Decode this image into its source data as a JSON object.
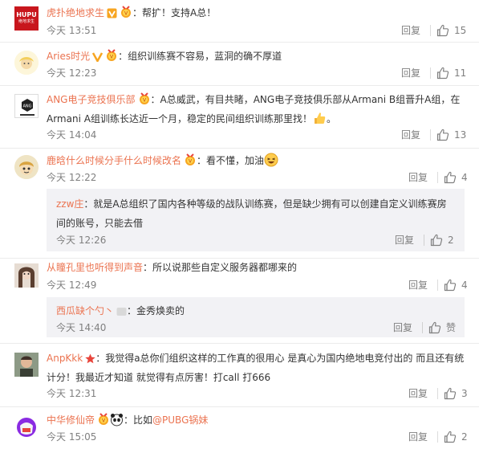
{
  "comments": [
    {
      "username": "虎扑绝地求生",
      "text": "：帮扩！支持A总！",
      "time": "今天 13:51",
      "reply_label": "回复",
      "likes": "15",
      "avatar_text": "HUPU",
      "avatar_subtext": "绝地求生"
    },
    {
      "username": "Aries时光",
      "text": "：组织训练赛不容易，蓝洞的确不厚道",
      "time": "今天 12:23",
      "reply_label": "回复",
      "likes": "11"
    },
    {
      "username": "ANG电子竞技俱乐部",
      "text_line1": "：A总威武，有目共睹，ANG电子竞技俱乐部从Armani B组晋升A组，在",
      "text_line2": "Armani A组训练长达近一个月，稳定的民间组织训练那里找！",
      "text_end": "。",
      "time": "今天 14:04",
      "reply_label": "回复",
      "likes": "13",
      "avatar_text": "ANG"
    },
    {
      "username": "鹿晗什么时候分手什么时候改名",
      "text": "：看不懂，加油",
      "time": "今天 12:22",
      "reply_label": "回复",
      "likes": "4",
      "sub": {
        "username": "zzw庄",
        "text_line1": "：就是A总组织了国内各种等级的战队训练赛，但是缺少拥有可以创建自定义训练赛房",
        "text_line2": "间的账号，只能去借",
        "time": "今天 12:26",
        "reply_label": "回复",
        "likes": "2"
      }
    },
    {
      "username": "从瞳孔里也听得到声音",
      "text": "：所以说那些自定义服务器都哪来的",
      "time": "今天 12:49",
      "reply_label": "回复",
      "likes": "4",
      "sub": {
        "username": "西瓜缺个勺丶",
        "text": "：金秀焕卖的",
        "time": "今天 14:40",
        "reply_label": "回复",
        "likes": "赞"
      }
    },
    {
      "username": "AnpKkk",
      "text_line1": "：我觉得a总你们组织这样的工作真的很用心 是真心为国内绝地电竞付出的 而且还有统",
      "text_line2": "计分！我最近才知道 就觉得有点厉害！打call 打666",
      "time": "今天 12:31",
      "reply_label": "回复",
      "likes": "3"
    },
    {
      "username": "中华修仙帝",
      "text_prefix": "：比如",
      "mention": "@PUBG锅妹",
      "time": "今天 15:05",
      "reply_label": "回复",
      "likes": "2"
    }
  ],
  "colors": {
    "username": "#eb7350",
    "text": "#333333",
    "meta": "#808080",
    "sub_bg": "#f2f2f5",
    "divider": "#ebebeb"
  }
}
